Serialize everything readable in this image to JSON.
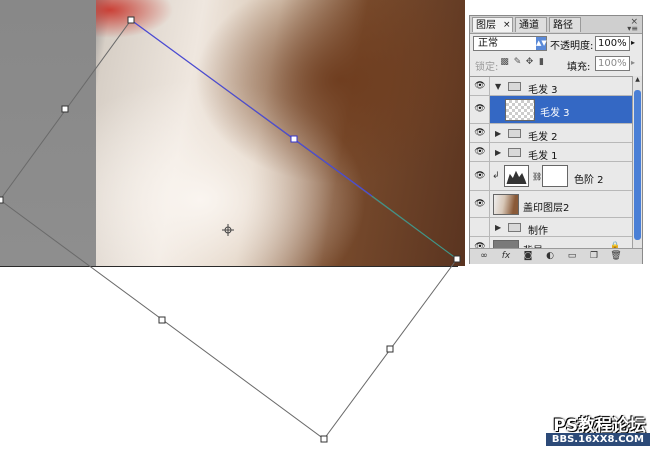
{
  "panel": {
    "tabs": [
      {
        "label": "图层",
        "active": true
      },
      {
        "label": "通道",
        "active": false
      },
      {
        "label": "路径",
        "active": false
      }
    ],
    "tab_close_glyph": "×",
    "panel_close_glyph": "×",
    "panel_menu_glyph": "▾≡",
    "blend_mode": "正常",
    "opacity_label": "不透明度:",
    "opacity_value": "100%",
    "lock_label": "锁定:",
    "fill_label": "填充:",
    "fill_value": "100%",
    "arrow_glyph": "▸"
  },
  "layers": [
    {
      "name": "毛发 3",
      "kind": "group",
      "expanded": true,
      "visible": true,
      "selected": false
    },
    {
      "name": "毛发 3",
      "kind": "layer",
      "visible": true,
      "selected": true
    },
    {
      "name": "毛发 2",
      "kind": "group",
      "expanded": false,
      "visible": true,
      "selected": false
    },
    {
      "name": "毛发 1",
      "kind": "group",
      "expanded": false,
      "visible": true,
      "selected": false
    },
    {
      "name": "色阶 2",
      "kind": "adjustment",
      "visible": true,
      "selected": false
    },
    {
      "name": "盖印图层2",
      "kind": "layer",
      "visible": true,
      "selected": false
    },
    {
      "name": "制作",
      "kind": "group",
      "expanded": false,
      "visible": false,
      "selected": false
    },
    {
      "name": "背景",
      "kind": "background",
      "visible": true,
      "selected": false
    }
  ],
  "footer_icons": [
    "link-icon",
    "fx-icon",
    "mask-icon",
    "adjustment-icon",
    "group-icon",
    "new-layer-icon",
    "trash-icon"
  ],
  "watermark": {
    "title": "PS教程论坛",
    "url": "BBS.16XX8.COM"
  },
  "glyphs": {
    "eye": "👁",
    "tri_down": "▼",
    "tri_right": "▶",
    "lock": "🔒"
  }
}
